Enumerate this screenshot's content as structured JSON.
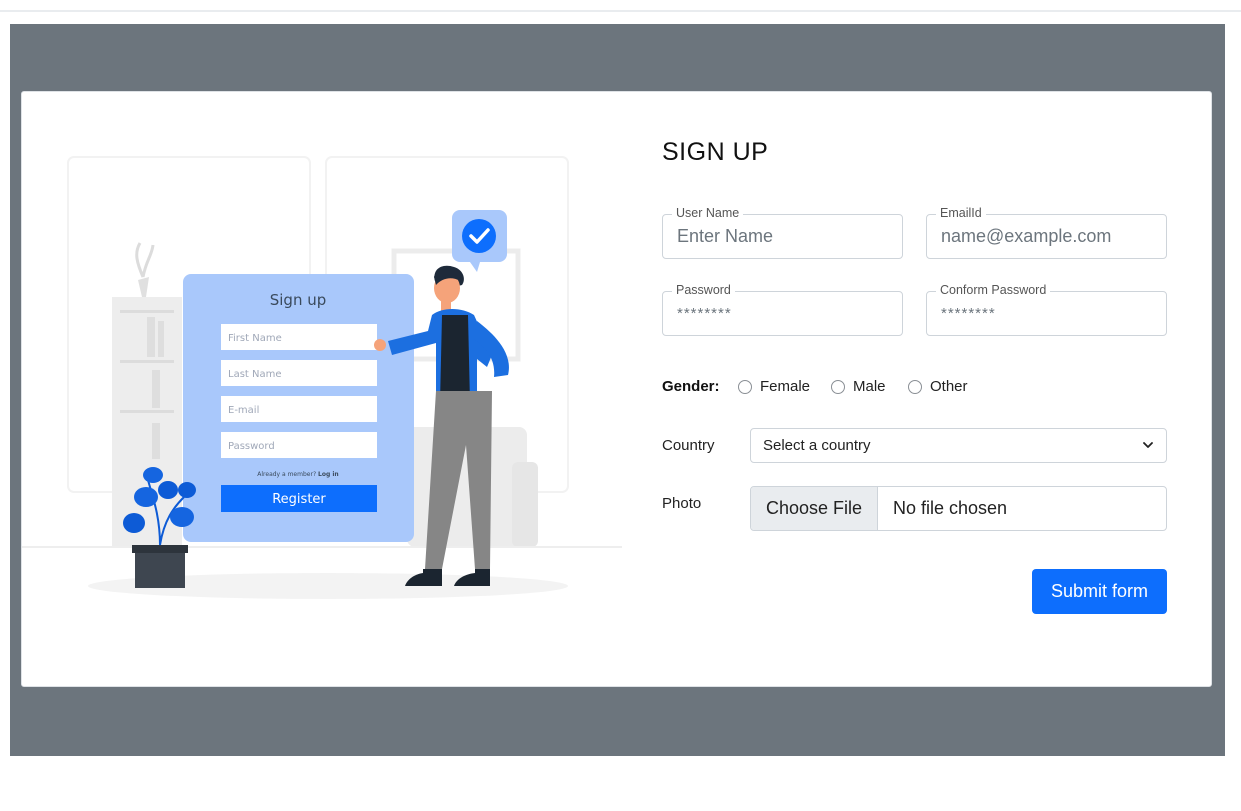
{
  "illustration": {
    "form_title": "Sign up",
    "fields": [
      "First Name",
      "Last Name",
      "E-mail",
      "Password"
    ],
    "already_member": "Already a member?",
    "login_link": "Log in",
    "register_button": "Register"
  },
  "form": {
    "title": "SIGN UP",
    "username": {
      "label": "User Name",
      "placeholder": "Enter Name"
    },
    "email": {
      "label": "EmailId",
      "placeholder": "name@example.com"
    },
    "password": {
      "label": "Password",
      "placeholder": "********"
    },
    "confirm_password": {
      "label": "Conform Password",
      "placeholder": "********"
    },
    "gender": {
      "label": "Gender:",
      "options": [
        "Female",
        "Male",
        "Other"
      ]
    },
    "country": {
      "label": "Country",
      "selected": "Select a country"
    },
    "photo": {
      "label": "Photo",
      "button": "Choose File",
      "status": "No file chosen"
    },
    "submit": "Submit form"
  },
  "colors": {
    "backdrop": "#6c757d",
    "primary": "#0d6efd",
    "illustration_panel": "#a9c8fb"
  }
}
